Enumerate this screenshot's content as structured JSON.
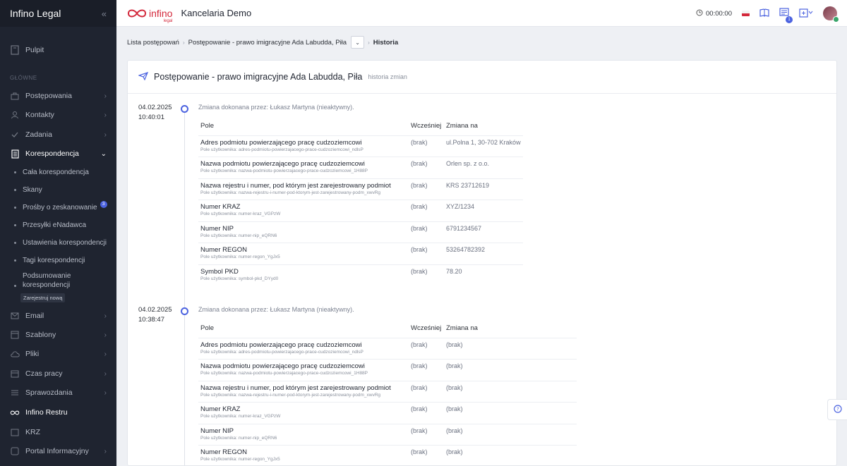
{
  "app": {
    "brand": "Infino Legal",
    "office_name": "Kancelaria Demo",
    "logo_text": "infino",
    "logo_sub": "legal"
  },
  "topbar": {
    "timer": "00:00:00",
    "notifications_count": "1"
  },
  "sidebar": {
    "top_item": "Pulpit",
    "section_label": "GŁÓWNE",
    "items": [
      {
        "label": "Postępowania",
        "icon": "briefcase-icon",
        "expandable": true
      },
      {
        "label": "Kontakty",
        "icon": "contacts-icon",
        "expandable": true
      },
      {
        "label": "Zadania",
        "icon": "tasks-icon",
        "expandable": true
      },
      {
        "label": "Korespondencja",
        "icon": "document-icon",
        "expandable": true,
        "active": true
      }
    ],
    "sub_items": [
      {
        "label": "Cała korespondencja"
      },
      {
        "label": "Skany"
      },
      {
        "label": "Prośby o zeskanowanie",
        "badge": "3"
      },
      {
        "label": "Przesyłki eNadawca"
      },
      {
        "label": "Ustawienia korespondencji"
      },
      {
        "label": "Tagi korespondencji"
      },
      {
        "label": "Podsumowanie korespondencji"
      }
    ],
    "new_button": "Zarejestruj nową",
    "items_after": [
      {
        "label": "Email",
        "icon": "mail-icon",
        "expandable": true
      },
      {
        "label": "Szablony",
        "icon": "template-icon",
        "expandable": true
      },
      {
        "label": "Pliki",
        "icon": "cloud-icon",
        "expandable": true
      },
      {
        "label": "Czas pracy",
        "icon": "time-icon",
        "expandable": true
      },
      {
        "label": "Sprawozdania",
        "icon": "report-icon",
        "expandable": true
      },
      {
        "label": "Infino Restru",
        "icon": "infinity-icon",
        "expandable": false
      },
      {
        "label": "KRZ",
        "icon": "krz-icon",
        "expandable": false
      },
      {
        "label": "Portal Informacyjny",
        "icon": "portal-icon",
        "expandable": true
      }
    ]
  },
  "breadcrumb": {
    "items": [
      "Lista postępowań",
      "Postępowanie - prawo imigracyjne Ada Labudda, Piła"
    ],
    "current": "Historia"
  },
  "card": {
    "title": "Postępowanie - prawo imigracyjne Ada Labudda, Piła",
    "subtitle": "historia zmian"
  },
  "table_headers": {
    "field": "Pole",
    "before": "Wcześniej",
    "after": "Zmiana na"
  },
  "entries": [
    {
      "date": "04.02.2025",
      "time": "10:40:01",
      "changed_by": "Zmiana dokonana przez: Łukasz Martyna (nieaktywny).",
      "rows": [
        {
          "name": "Adres podmiotu powierzającego pracę cudzoziemcowi",
          "key": "Pole użytkownika: adres-podmiotu-powierzajacego-prace-cudzoziemcowi_ndlsP",
          "before": "(brak)",
          "after": "ul.Polna 1, 30-702 Kraków"
        },
        {
          "name": "Nazwa podmiotu powierzającego pracę cudzoziemcowi",
          "key": "Pole użytkownika: nazwa-podmiotu-powierzajacego-prace-cudzoziemcowi_1H88P",
          "before": "(brak)",
          "after": "Orlen sp. z o.o."
        },
        {
          "name": "Nazwa rejestru i numer, pod którym jest zarejestrowany podmiot",
          "key": "Pole użytkownika: nazwa-rejestru-i-numer-pod-ktorym-jest-zarejestrowany-podm_xwvRg",
          "before": "(brak)",
          "after": "KRS 23712619"
        },
        {
          "name": "Numer KRAZ",
          "key": "Pole użytkownika: numer-kraz_VGPzW",
          "before": "(brak)",
          "after": "XYZ/1234"
        },
        {
          "name": "Numer NIP",
          "key": "Pole użytkownika: numer-nip_eQRN6",
          "before": "(brak)",
          "after": "6791234567"
        },
        {
          "name": "Numer REGON",
          "key": "Pole użytkownika: numer-regon_YgJx5",
          "before": "(brak)",
          "after": "53264782392"
        },
        {
          "name": "Symbol PKD",
          "key": "Pole użytkownika: symbol-pkd_DYyd0",
          "before": "(brak)",
          "after": "78.20"
        }
      ]
    },
    {
      "date": "04.02.2025",
      "time": "10:38:47",
      "changed_by": "Zmiana dokonana przez: Łukasz Martyna (nieaktywny).",
      "rows": [
        {
          "name": "Adres podmiotu powierzającego pracę cudzoziemcowi",
          "key": "Pole użytkownika: adres-podmiotu-powierzajacego-prace-cudzoziemcowi_ndlsP",
          "before": "(brak)",
          "after": "(brak)"
        },
        {
          "name": "Nazwa podmiotu powierzającego pracę cudzoziemcowi",
          "key": "Pole użytkownika: nazwa-podmiotu-powierzajacego-prace-cudzoziemcowi_1H88P",
          "before": "(brak)",
          "after": "(brak)"
        },
        {
          "name": "Nazwa rejestru i numer, pod którym jest zarejestrowany podmiot",
          "key": "Pole użytkownika: nazwa-rejestru-i-numer-pod-ktorym-jest-zarejestrowany-podm_xwvRg",
          "before": "(brak)",
          "after": "(brak)"
        },
        {
          "name": "Numer KRAZ",
          "key": "Pole użytkownika: numer-kraz_VGPzW",
          "before": "(brak)",
          "after": "(brak)"
        },
        {
          "name": "Numer NIP",
          "key": "Pole użytkownika: numer-nip_eQRN6",
          "before": "(brak)",
          "after": "(brak)"
        },
        {
          "name": "Numer REGON",
          "key": "Pole użytkownika: numer-regon_YgJx5",
          "before": "(brak)",
          "after": "(brak)"
        }
      ]
    }
  ],
  "colors": {
    "accent": "#4c63e0",
    "brand_red": "#d3283b",
    "sidebar_bg": "#1f2430"
  }
}
